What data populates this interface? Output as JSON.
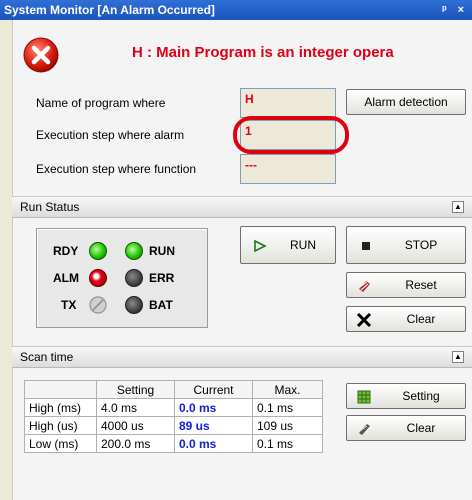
{
  "window": {
    "title": "System Monitor [An Alarm Occurred]",
    "controls": "ᵖ ×"
  },
  "alarm": {
    "message": "H : Main Program is an integer opera",
    "fields": [
      {
        "label": "Name of program where",
        "value": "H"
      },
      {
        "label": "Execution step where alarm",
        "value": "1"
      },
      {
        "label": "Execution step where function",
        "value": "---"
      }
    ],
    "detection_button": "Alarm detection"
  },
  "run_status": {
    "title": "Run Status",
    "leds": [
      {
        "label": "RDY",
        "state": "green"
      },
      {
        "label": "RUN",
        "state": "green"
      },
      {
        "label": "ALM",
        "state": "red"
      },
      {
        "label": "ERR",
        "state": "dark"
      },
      {
        "label": "TX",
        "state": "disabled"
      },
      {
        "label": "BAT",
        "state": "dark"
      }
    ],
    "buttons": {
      "run": "RUN",
      "stop": "STOP",
      "reset": "Reset",
      "clear": "Clear"
    }
  },
  "scan_time": {
    "title": "Scan time",
    "headers": [
      "",
      "Setting",
      "Current",
      "Max."
    ],
    "rows": [
      [
        "High (ms)",
        "4.0 ms",
        "0.0 ms",
        "0.1 ms"
      ],
      [
        "High (us)",
        "4000 us",
        "89 us",
        "109 us"
      ],
      [
        "Low (ms)",
        "200.0 ms",
        "0.0 ms",
        "0.1 ms"
      ]
    ],
    "buttons": {
      "setting": "Setting",
      "clear": "Clear"
    }
  },
  "colors": {
    "alarm_red": "#e0001a",
    "current_blue": "#1020e0",
    "led_green": "#21c400",
    "led_red": "#e8001a"
  }
}
